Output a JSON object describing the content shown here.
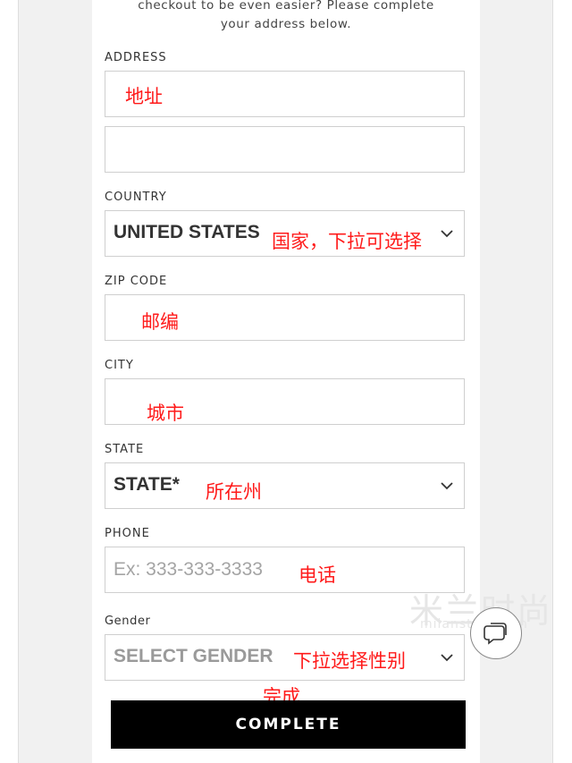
{
  "intro": {
    "line1": "checkout to be even easier? Please complete",
    "line2": "your address below."
  },
  "fields": {
    "address": {
      "label": "ADDRESS",
      "annotation": "地址"
    },
    "address2": {
      "label": ""
    },
    "country": {
      "label": "COUNTRY",
      "value": "UNITED STATES",
      "annotation": "国家，下拉可选择"
    },
    "zip": {
      "label": "ZIP CODE",
      "annotation": "邮编"
    },
    "city": {
      "label": "CITY",
      "annotation": "城市"
    },
    "state": {
      "label": "STATE",
      "value": "STATE*",
      "annotation": "所在州"
    },
    "phone": {
      "label": "PHONE",
      "placeholder": "Ex: 333-333-3333",
      "annotation": "电话"
    },
    "gender": {
      "label": "Gender",
      "value": "SELECT GENDER",
      "annotation": "下拉选择性别"
    }
  },
  "complete": {
    "label": "COMPLETE",
    "annotation": "完成"
  },
  "icons": {
    "chevron": "chevron-down-icon",
    "chat": "chat-bubble-icon"
  },
  "colors": {
    "annotation": "#ff1a1a",
    "button_bg": "#000000",
    "button_text": "#ffffff"
  },
  "watermark": {
    "main": "米兰时尚",
    "sub": "milanstyle.com"
  }
}
